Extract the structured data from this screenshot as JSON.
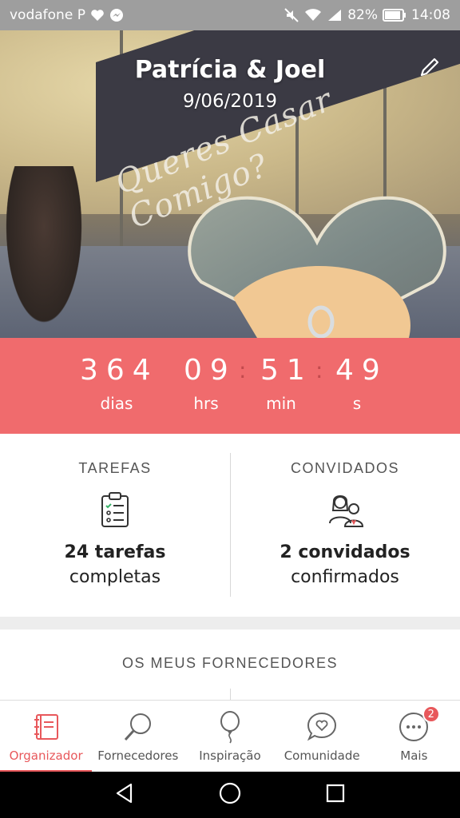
{
  "statusbar": {
    "carrier": "vodafone P",
    "battery": "82%",
    "time": "14:08"
  },
  "hero": {
    "couple_names": "Patrícia & Joel",
    "wedding_date": "9/06/2019",
    "sail_text": "Queres Casar Comigo?"
  },
  "countdown": {
    "days": "364",
    "hours": "09",
    "minutes": "51",
    "seconds": "49",
    "days_label": "dias",
    "hours_label": "hrs",
    "minutes_label": "min",
    "seconds_label": "s"
  },
  "stats": {
    "tasks": {
      "title": "TAREFAS",
      "main": "24 tarefas",
      "sub": "completas"
    },
    "guests": {
      "title": "CONVIDADOS",
      "main": "2 convidados",
      "sub": "confirmados"
    }
  },
  "providers": {
    "title": "OS MEUS FORNECEDORES"
  },
  "bottomnav": {
    "items": [
      {
        "label": "Organizador",
        "icon": "planner-icon",
        "active": true
      },
      {
        "label": "Fornecedores",
        "icon": "search-icon",
        "active": false
      },
      {
        "label": "Inspiração",
        "icon": "balloon-icon",
        "active": false
      },
      {
        "label": "Comunidade",
        "icon": "chat-heart-icon",
        "active": false
      },
      {
        "label": "Mais",
        "icon": "more-icon",
        "active": false,
        "badge": "2"
      }
    ]
  },
  "colors": {
    "accent": "#f06b6d",
    "active": "#e8585b"
  }
}
